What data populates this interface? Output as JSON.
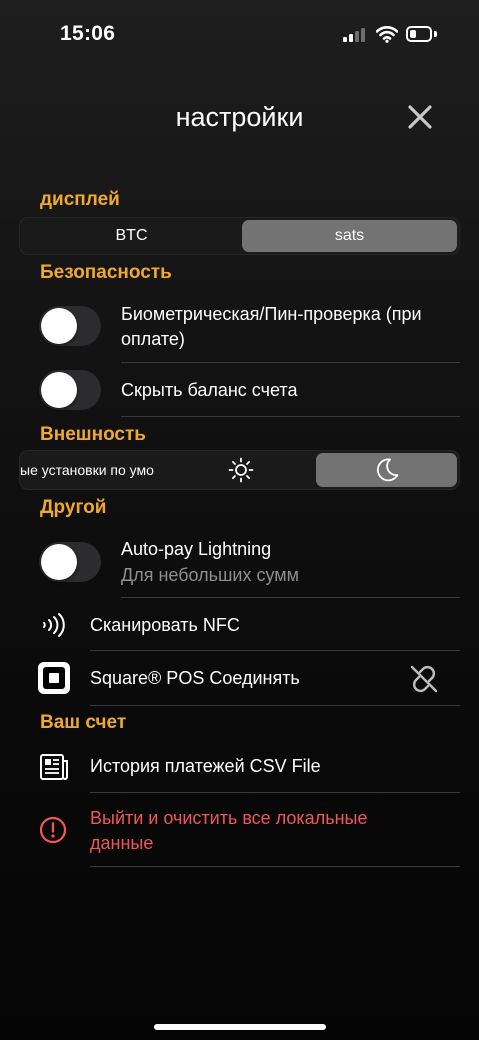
{
  "status_bar": {
    "time": "15:06"
  },
  "header": {
    "title": "настройки"
  },
  "sections": {
    "display": {
      "title": "дисплей",
      "unit_options": [
        "BTC",
        "sats"
      ],
      "selected": "sats"
    },
    "security": {
      "title": "Безопасность",
      "biometric_label": "Биометрическая/Пин-проверка (при оплате)",
      "biometric_enabled": false,
      "hide_balance_label": "Скрыть баланс счета",
      "hide_balance_enabled": false
    },
    "appearance": {
      "title": "Внешность",
      "system_label": "ые установки по умо",
      "selected": "dark",
      "light_icon": "sun-icon",
      "dark_icon": "moon-icon"
    },
    "other": {
      "title": "Другой",
      "autopay_label": "Auto-pay Lightning",
      "autopay_sub": "Для небольших сумм",
      "autopay_enabled": false,
      "nfc_label": "Сканировать NFC",
      "nfc_icon": "nfc-icon",
      "square_label": "Square® POS Соединять",
      "square_icon": "square-logo-icon",
      "square_status_icon": "unlinked-icon"
    },
    "account": {
      "title": "Ваш счет",
      "history_label": "История платежей CSV File",
      "history_icon": "document-icon",
      "logout_label": "Выйти и очистить все локальные данные",
      "logout_icon": "alert-circle-icon"
    }
  },
  "colors": {
    "accent": "#f0a830",
    "danger": "#f2555a",
    "segment_selected": "#737373",
    "toggle_off": "#2c2c2e",
    "muted": "#8e8e93"
  }
}
